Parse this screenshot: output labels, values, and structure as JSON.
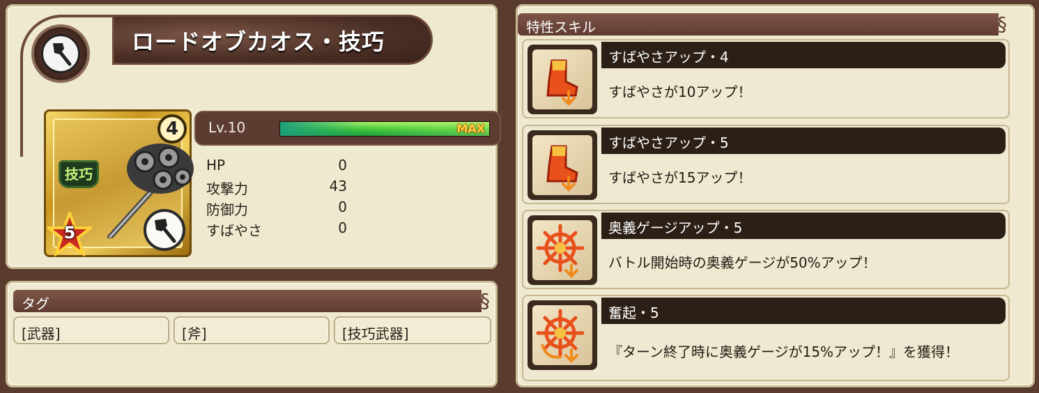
{
  "weapon": {
    "name": "ロードオブカオス・技巧",
    "type_icon": "axe-icon",
    "rank": "4",
    "craft_tag": "技巧",
    "rarity": "5",
    "level_label": "Lv.10",
    "xp_fraction": 1.0,
    "max_label": "MAX",
    "stats": [
      {
        "name": "HP",
        "value": "0"
      },
      {
        "name": "攻撃力",
        "value": "43"
      },
      {
        "name": "防御力",
        "value": "0"
      },
      {
        "name": "すばやさ",
        "value": "0"
      }
    ]
  },
  "tags": {
    "header": "タグ",
    "items": [
      "[武器]",
      "[斧]",
      "[技巧武器]"
    ]
  },
  "skills": {
    "header": "特性スキル",
    "items": [
      {
        "title": "すばやさアップ・4",
        "desc": "すばやさが10アップ！",
        "icon": "boot-speed-icon"
      },
      {
        "title": "すばやさアップ・5",
        "desc": "すばやさが15アップ！",
        "icon": "boot-speed-icon"
      },
      {
        "title": "奥義ゲージアップ・5",
        "desc": "バトル開始時の奥義ゲージが50%アップ！",
        "icon": "burst-gauge-icon"
      },
      {
        "title": "奮起・5",
        "desc": "『ターン終了時に奥義ゲージが15%アップ！』を獲得！",
        "icon": "rally-gauge-icon"
      }
    ]
  },
  "colors": {
    "panel": "#efe9d0",
    "header_strip": "#6a4337",
    "xp_bar": "#46c83a",
    "max_text": "#ffd23a"
  }
}
